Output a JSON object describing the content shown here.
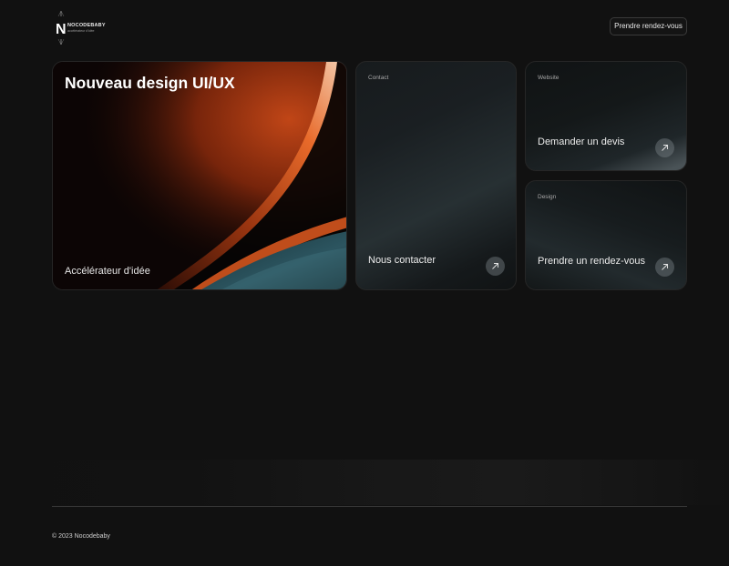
{
  "brand": {
    "name": "NOCODEBABY",
    "tagline": "accélérateur d'idée",
    "accent": "#e0511a"
  },
  "header": {
    "cta_label": "Prendre rendez-vous"
  },
  "cards": {
    "main": {
      "title": "Nouveau design UI/UX",
      "subtitle": "Accélérateur d'idée"
    },
    "contact": {
      "tag": "Contact",
      "label": "Nous contacter",
      "icon": "arrow-up-right-icon"
    },
    "website": {
      "tag": "Website",
      "label": "Demander un devis",
      "icon": "arrow-up-right-icon"
    },
    "design": {
      "tag": "Design",
      "label": "Prendre un rendez-vous",
      "icon": "arrow-up-right-icon"
    }
  },
  "footer": {
    "copyright": "© 2023 Nocodebaby"
  }
}
